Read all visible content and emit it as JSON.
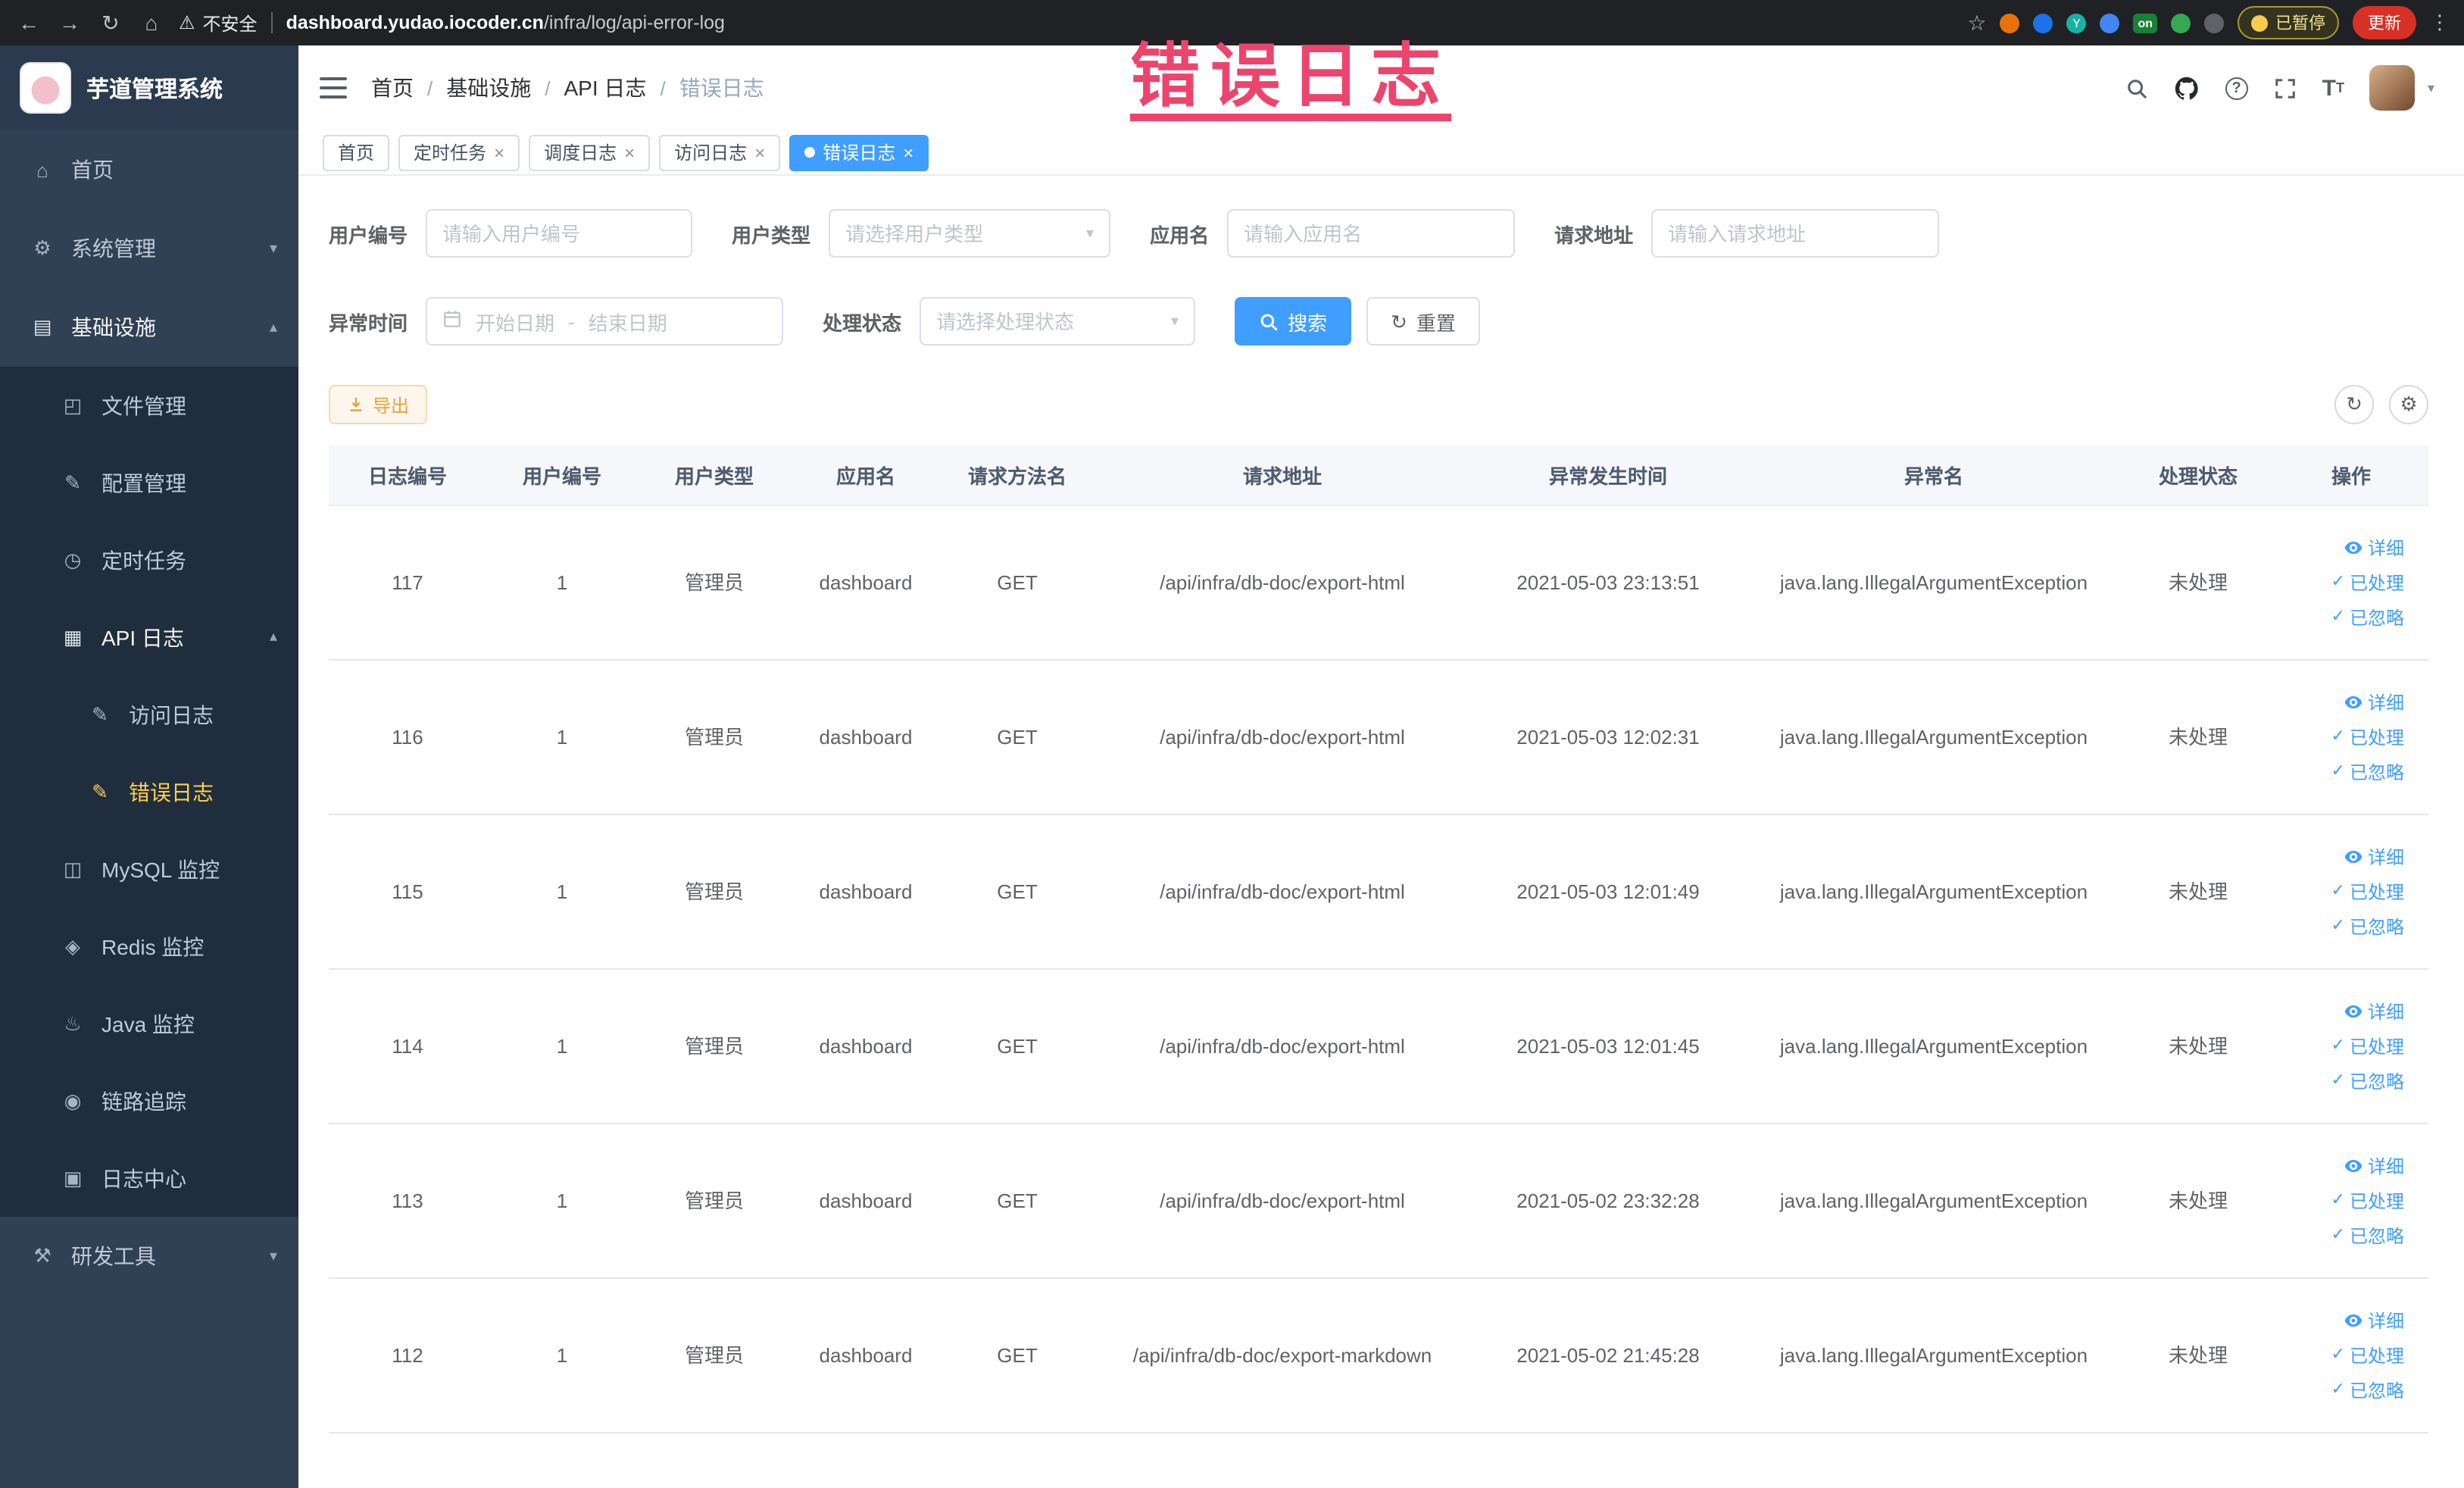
{
  "browser": {
    "security_label": "不安全",
    "url_host": "dashboard.yudao.iocoder.cn",
    "url_path": "/infra/log/api-error-log",
    "paused_badge": "已暂停",
    "update_button": "更新",
    "extension_badge_on": "on"
  },
  "annotation": {
    "text": "错误日志"
  },
  "sidebar": {
    "logo_title": "芋道管理系统",
    "menu": [
      {
        "label": "首页"
      },
      {
        "label": "系统管理"
      },
      {
        "label": "基础设施",
        "children": [
          {
            "label": "文件管理"
          },
          {
            "label": "配置管理"
          },
          {
            "label": "定时任务"
          },
          {
            "label": "API 日志",
            "children": [
              {
                "label": "访问日志"
              },
              {
                "label": "错误日志",
                "active": true
              }
            ]
          },
          {
            "label": "MySQL 监控"
          },
          {
            "label": "Redis 监控"
          },
          {
            "label": "Java 监控"
          },
          {
            "label": "链路追踪"
          },
          {
            "label": "日志中心"
          }
        ]
      },
      {
        "label": "研发工具"
      }
    ]
  },
  "header": {
    "breadcrumb": [
      "首页",
      "基础设施",
      "API 日志",
      "错误日志"
    ]
  },
  "tabs": [
    {
      "label": "首页",
      "closable": false,
      "active": false
    },
    {
      "label": "定时任务",
      "closable": true,
      "active": false
    },
    {
      "label": "调度日志",
      "closable": true,
      "active": false
    },
    {
      "label": "访问日志",
      "closable": true,
      "active": false
    },
    {
      "label": "错误日志",
      "closable": true,
      "active": true
    }
  ],
  "filters": {
    "user_id_label": "用户编号",
    "user_id_placeholder": "请输入用户编号",
    "user_type_label": "用户类型",
    "user_type_placeholder": "请选择用户类型",
    "app_name_label": "应用名",
    "app_name_placeholder": "请输入应用名",
    "request_url_label": "请求地址",
    "request_url_placeholder": "请输入请求地址",
    "time_label": "异常时间",
    "time_start_placeholder": "开始日期",
    "time_separator": "-",
    "time_end_placeholder": "结束日期",
    "status_label": "处理状态",
    "status_placeholder": "请选择处理状态",
    "search_button": "搜索",
    "reset_button": "重置"
  },
  "toolbar": {
    "export_button": "导出"
  },
  "table": {
    "columns": [
      "日志编号",
      "用户编号",
      "用户类型",
      "应用名",
      "请求方法名",
      "请求地址",
      "异常发生时间",
      "异常名",
      "处理状态",
      "操作"
    ],
    "actions": [
      "详细",
      "已处理",
      "已忽略"
    ],
    "rows": [
      {
        "id": "117",
        "user_id": "1",
        "user_type": "管理员",
        "app": "dashboard",
        "method": "GET",
        "url": "/api/infra/db-doc/export-html",
        "time": "2021-05-03 23:13:51",
        "exception": "java.lang.IllegalArgumentException",
        "status": "未处理"
      },
      {
        "id": "116",
        "user_id": "1",
        "user_type": "管理员",
        "app": "dashboard",
        "method": "GET",
        "url": "/api/infra/db-doc/export-html",
        "time": "2021-05-03 12:02:31",
        "exception": "java.lang.IllegalArgumentException",
        "status": "未处理"
      },
      {
        "id": "115",
        "user_id": "1",
        "user_type": "管理员",
        "app": "dashboard",
        "method": "GET",
        "url": "/api/infra/db-doc/export-html",
        "time": "2021-05-03 12:01:49",
        "exception": "java.lang.IllegalArgumentException",
        "status": "未处理"
      },
      {
        "id": "114",
        "user_id": "1",
        "user_type": "管理员",
        "app": "dashboard",
        "method": "GET",
        "url": "/api/infra/db-doc/export-html",
        "time": "2021-05-03 12:01:45",
        "exception": "java.lang.IllegalArgumentException",
        "status": "未处理"
      },
      {
        "id": "113",
        "user_id": "1",
        "user_type": "管理员",
        "app": "dashboard",
        "method": "GET",
        "url": "/api/infra/db-doc/export-html",
        "time": "2021-05-02 23:32:28",
        "exception": "java.lang.IllegalArgumentException",
        "status": "未处理"
      },
      {
        "id": "112",
        "user_id": "1",
        "user_type": "管理员",
        "app": "dashboard",
        "method": "GET",
        "url": "/api/infra/db-doc/export-markdown",
        "time": "2021-05-02 21:45:28",
        "exception": "java.lang.IllegalArgumentException",
        "status": "未处理"
      }
    ]
  },
  "icons": {
    "back": "←",
    "forward": "→",
    "reload": "↻",
    "home": "⌂",
    "warning": "⚠",
    "star": "☆",
    "menu_dots": "⋮",
    "sidebar_home": "⌂",
    "gear": "⚙",
    "infrastructure": "▤",
    "file": "◰",
    "config": "✎",
    "timer": "◷",
    "api_log": "▦",
    "access_log": "✎",
    "error_log": "✎",
    "mysql": "◫",
    "redis": "◈",
    "java": "♨",
    "trace": "◉",
    "log_center": "▣",
    "tools": "⚒",
    "chevron_down": "▾",
    "chevron_up": "▴",
    "caret_down": "▾",
    "check": "✓",
    "refresh": "↻",
    "settings": "⚙",
    "close": "×"
  }
}
